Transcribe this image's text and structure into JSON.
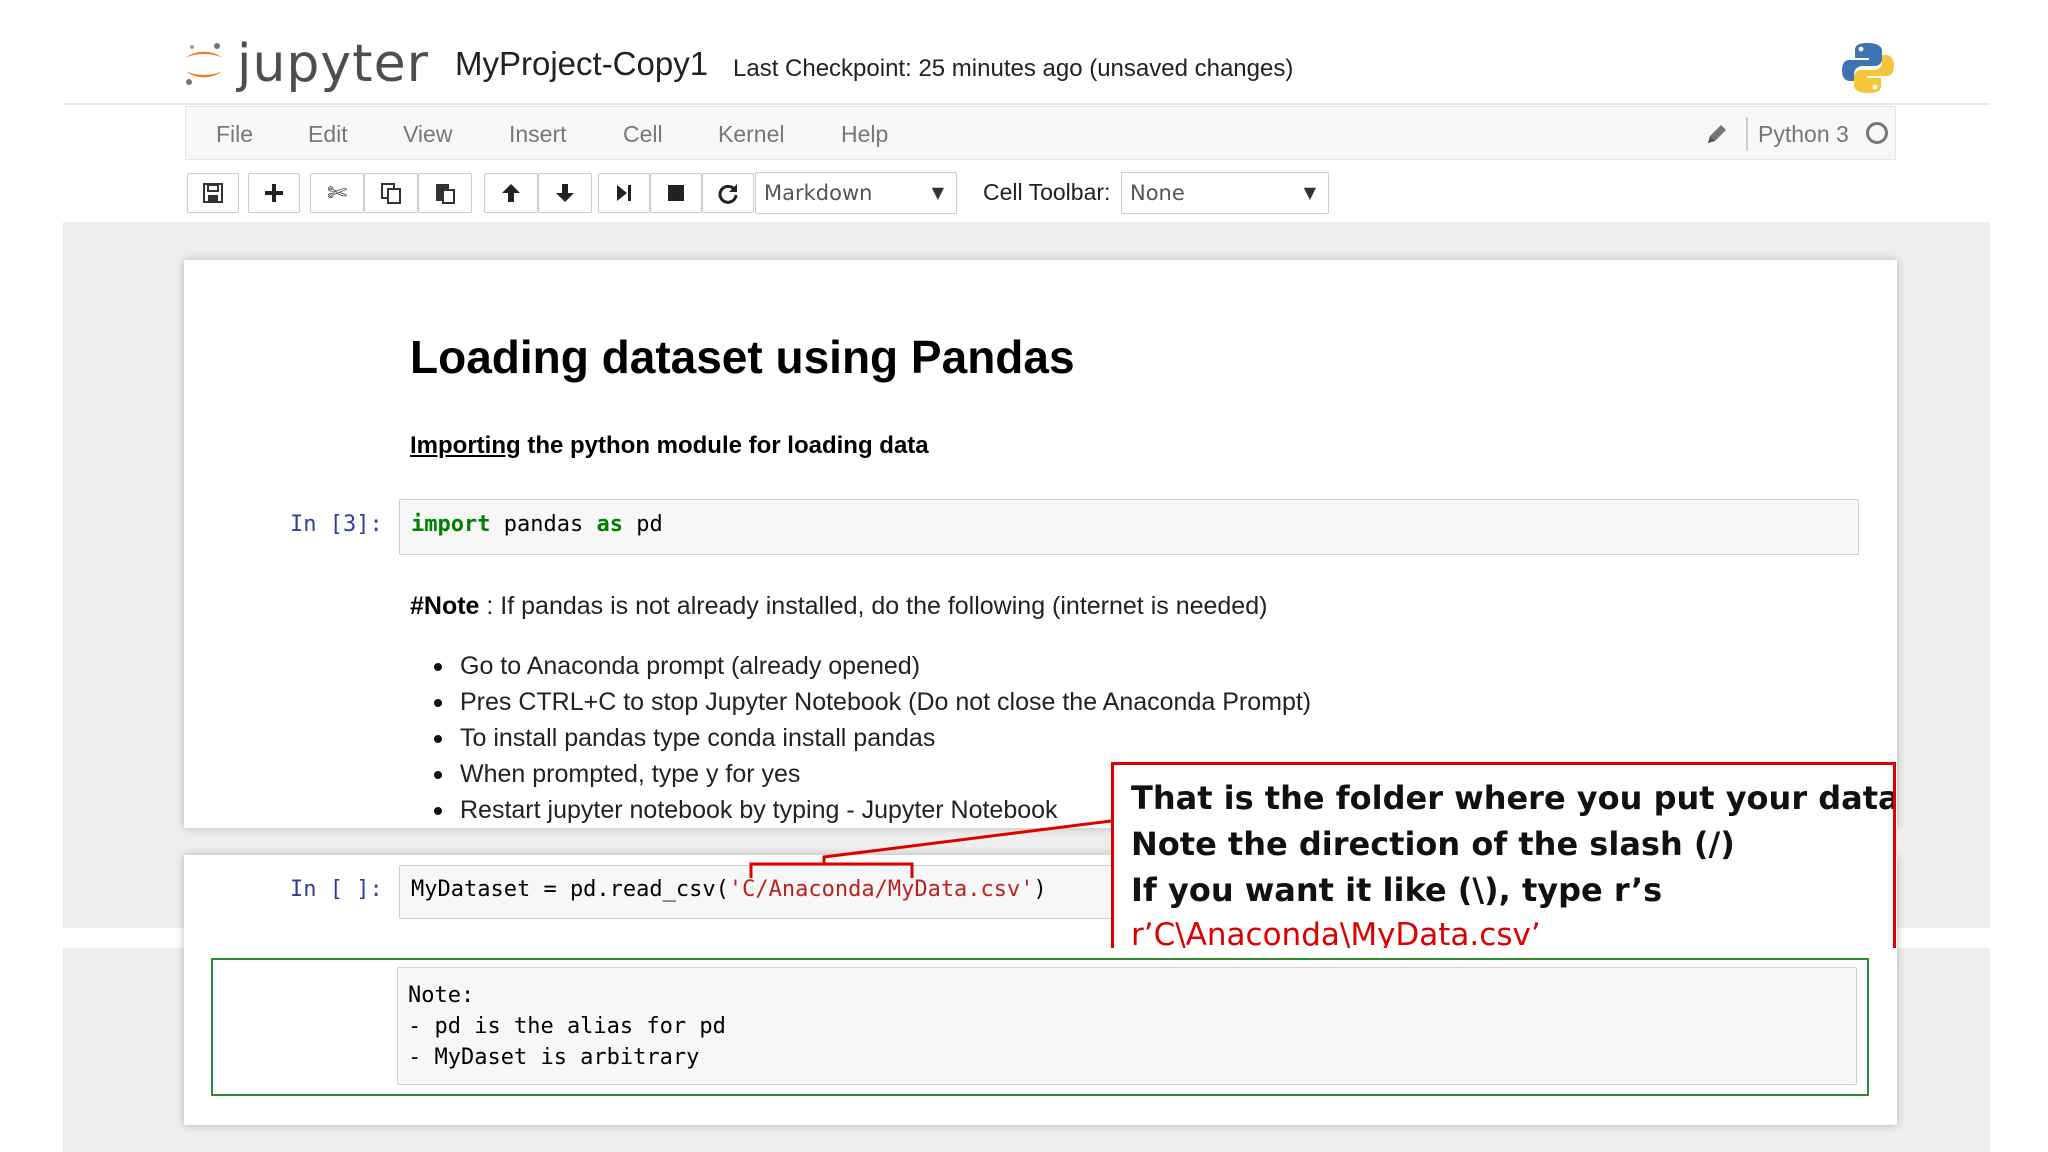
{
  "header": {
    "logo_text": "jupyter",
    "notebook_name": "MyProject-Copy1",
    "checkpoint": "Last Checkpoint: 25 minutes ago (unsaved changes)"
  },
  "menubar": {
    "items": [
      "File",
      "Edit",
      "View",
      "Insert",
      "Cell",
      "Kernel",
      "Help"
    ],
    "kernel_name": "Python 3"
  },
  "toolbar": {
    "buttons": [
      "save-icon",
      "add-cell-icon",
      "cut-icon",
      "copy-icon",
      "paste-icon",
      "move-up-icon",
      "move-down-icon",
      "run-icon",
      "stop-icon",
      "restart-icon"
    ],
    "cell_type": "Markdown",
    "cell_toolbar_label": "Cell Toolbar:",
    "cell_toolbar_value": "None"
  },
  "notebook": {
    "heading": "Loading dataset using Pandas",
    "subheading_underlined": "Importing",
    "subheading_rest": " the python module for loading data",
    "cell1": {
      "prompt": "In [3]:",
      "kw_import": "import",
      "module": " pandas ",
      "kw_as": "as",
      "alias": " pd"
    },
    "note": {
      "label": "#Note",
      "text": " : If pandas is not already installed, do the following (internet is needed)"
    },
    "bullets": [
      "Go to Anaconda prompt (already opened)",
      "Pres CTRL+C to stop Jupyter Notebook (Do not close the Anaconda Prompt)",
      "To install pandas type conda install pandas",
      "When prompted, type y for yes",
      "Restart jupyter notebook by typing - Jupyter Notebook"
    ],
    "cell2": {
      "prompt": "In [ ]:",
      "code_before": "MyDataset = pd.read_csv(",
      "code_string": "'C/Anaconda/MyData.csv'",
      "code_after": ")"
    }
  },
  "callout": {
    "line1": "That is the folder where you put your dataset.",
    "line2": "Note the direction of the slash (/)",
    "line3": "If you want it like (\\), type r’s",
    "line4": "r’C\\Anaconda\\MyData.csv’"
  },
  "green_note": {
    "text": "Note:\n- pd is the alias for pd\n- MyDaset is arbitrary"
  },
  "colors": {
    "accent_orange": "#f37626",
    "prompt_blue": "#303f9f",
    "keyword_green": "#008000",
    "string_red": "#ba2121",
    "callout_red": "#dd0000",
    "note_green": "#2e8b2e"
  }
}
